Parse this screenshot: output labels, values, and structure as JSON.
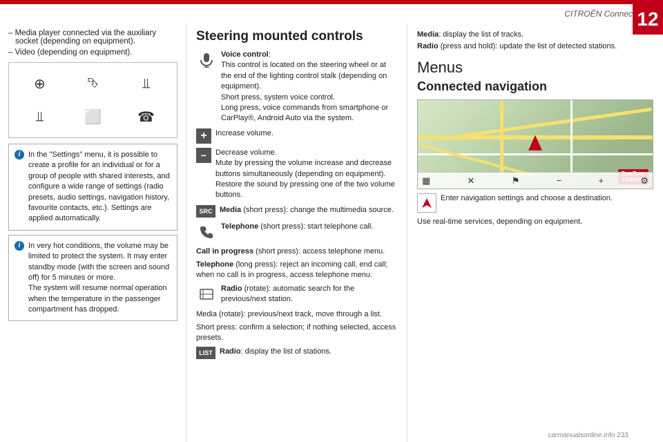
{
  "header": {
    "title": "CITROËN Connect Nav",
    "page_number": "12"
  },
  "left_col": {
    "bullets": [
      "–  Media player connected via the auxiliary socket (depending on equipment).",
      "–  Video (depending on equipment)."
    ],
    "icons": [
      "gps",
      "bluetooth",
      "usb",
      "usb2",
      "grid",
      "phone"
    ],
    "info_box_1": {
      "icon": "i",
      "text": "In the \"Settings\" menu, it is possible to create a profile for an individual or for a group of people with shared interests, and configure a wide range of settings (radio presets, audio settings, navigation history, favourite contacts, etc.). Settings are applied automatically."
    },
    "info_box_2": {
      "icon": "i",
      "text": "In very hot conditions, the volume may be limited to protect the system. It may enter standby mode (with the screen and sound off) for 5 minutes or more.\nThe system will resume normal operation when the temperature in the passenger compartment has dropped."
    }
  },
  "middle_col": {
    "title": "Steering mounted controls",
    "controls": [
      {
        "icon_type": "mic",
        "label": "Voice control",
        "text": "This control is located on the steering wheel or at the end of the lighting control stalk (depending on equipment).\nShort press, system voice control.\nLong press, voice commands from smartphone or CarPlay®, Android Auto via the system."
      },
      {
        "icon_type": "plus",
        "text": "Increase volume."
      },
      {
        "icon_type": "minus",
        "text": "Decrease volume.\nMute by pressing the volume increase and decrease buttons simultaneously (depending on equipment).\nRestore the sound by pressing one of the two volume buttons."
      },
      {
        "icon_type": "SRC",
        "label": "Media",
        "text": "(short press): change the multimedia source."
      },
      {
        "icon_type": "phone",
        "label": "Telephone",
        "text": "(short press): start telephone call."
      }
    ],
    "extra_text": [
      {
        "bold": "Call in progress",
        "text": " (short press): access telephone menu."
      },
      {
        "bold": "Telephone",
        "text": " (long press): reject an incoming call, end call; when no call is in progress, access telephone menu."
      }
    ],
    "radio_row": {
      "icon_type": "dial",
      "label": "Radio",
      "text": "(rotate): automatic search for the previous/next station."
    },
    "media_rotate": "Media (rotate): previous/next track, move through a list.",
    "short_press": "Short press: confirm a selection; if nothing selected, access presets.",
    "list_row": {
      "icon_type": "LIST",
      "label": "Radio",
      "text": ": display the list of stations."
    }
  },
  "right_col": {
    "top_text": [
      {
        "bold": "Media",
        "text": ": display the list of tracks."
      },
      {
        "bold": "Radio",
        "text": " (press and hold): update the list of detected stations."
      }
    ],
    "menus_heading": "Menus",
    "connected_nav_heading": "Connected navigation",
    "map_toolbar_icons": [
      "grid-icon",
      "cursor-icon",
      "pin-icon",
      "minus-icon",
      "plus-icon",
      "settings-icon"
    ],
    "nav_info": {
      "icon": "arrow",
      "text": "Enter navigation settings and choose a destination."
    },
    "use_text": "Use real-time services, depending on equipment.",
    "tomtom_label": "TomTom\nTRAFFIC"
  },
  "watermark": "carmanualsonline.info 233"
}
